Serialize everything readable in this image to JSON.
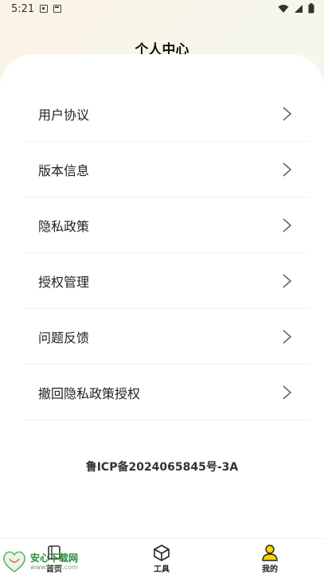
{
  "status_bar": {
    "time": "5:21"
  },
  "header": {
    "title": "个人中心"
  },
  "menu": {
    "items": [
      {
        "label": "用户协议"
      },
      {
        "label": "版本信息"
      },
      {
        "label": "隐私政策"
      },
      {
        "label": "授权管理"
      },
      {
        "label": "问题反馈"
      },
      {
        "label": "撤回隐私政策授权"
      }
    ]
  },
  "footer": {
    "icp": "鲁ICP备2024065845号-3A"
  },
  "tabbar": {
    "items": [
      {
        "label": "首页",
        "icon": "home-icon"
      },
      {
        "label": "工具",
        "icon": "box-icon"
      },
      {
        "label": "我的",
        "icon": "user-icon",
        "active": true
      }
    ],
    "active_color": "#f5d400"
  },
  "watermark": {
    "text": "安心下载网",
    "url": "www.anxz.com"
  }
}
